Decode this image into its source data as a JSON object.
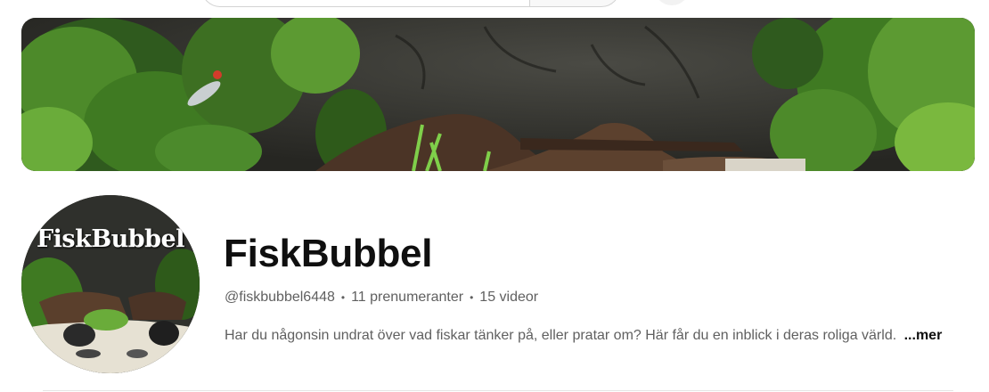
{
  "channel": {
    "name": "FiskBubbel",
    "handle": "@fiskbubbel6448",
    "subscribers": "11 prenumeranter",
    "videos": "15 videor",
    "separator": "•",
    "description": "Har du någonsin undrat över vad fiskar tänker på, eller pratar om? Här får du en inblick i deras roliga värld.",
    "more_label": "...mer",
    "avatar_text": "FiskBubbel"
  },
  "colors": {
    "text_primary": "#0f0f0f",
    "text_secondary": "#606060",
    "divider": "#e5e5e5"
  }
}
